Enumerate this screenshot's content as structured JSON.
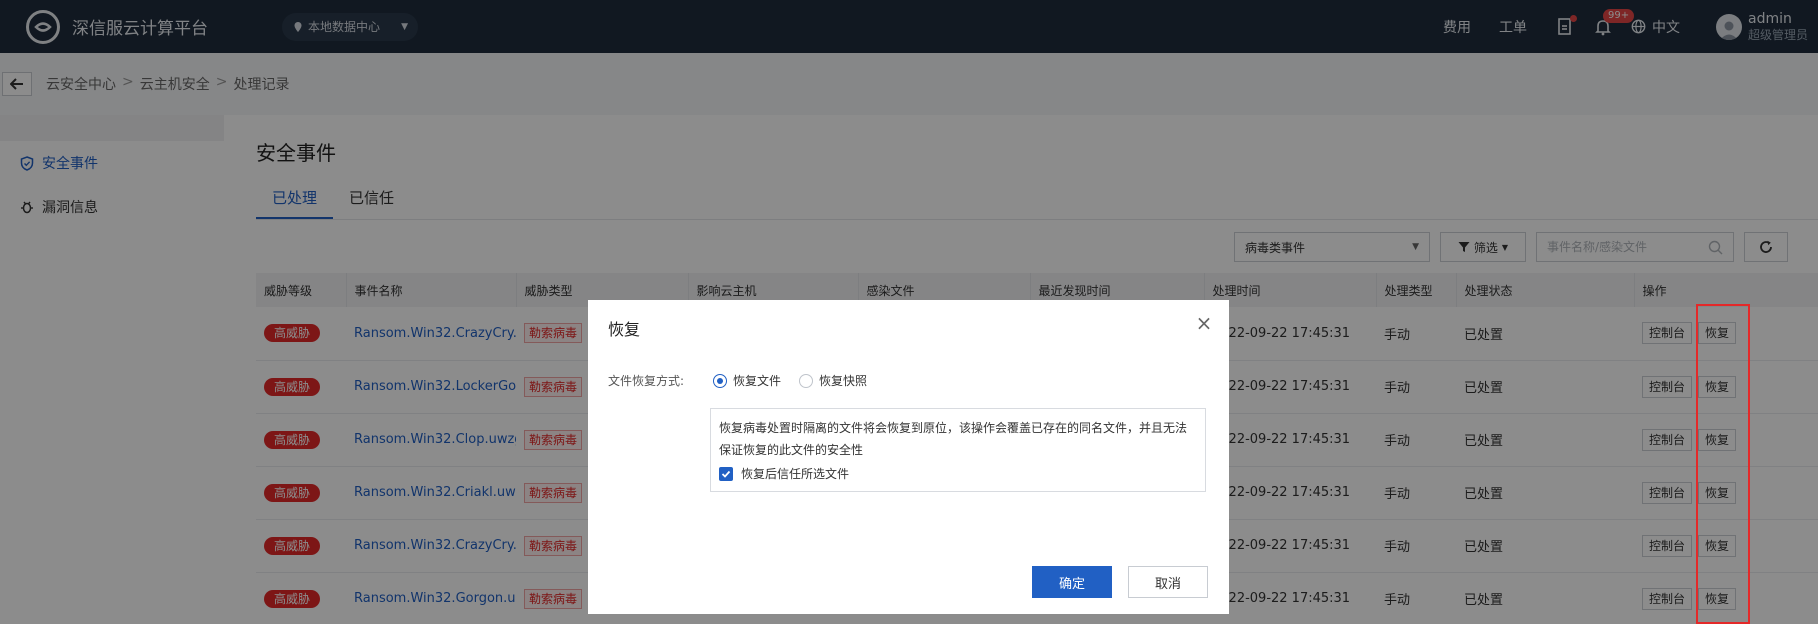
{
  "topbar": {
    "app_title": "深信服云计算平台",
    "datacenter": "本地数据中心",
    "links": {
      "fee": "费用",
      "ticket": "工单"
    },
    "notif_badge": "99+",
    "lang": "中文",
    "user_name": "admin",
    "user_role": "超级管理员"
  },
  "breadcrumb": {
    "items": [
      "云安全中心",
      "云主机安全",
      "处理记录"
    ],
    "separator": ">"
  },
  "sidebar": {
    "items": [
      {
        "label": "安全事件"
      },
      {
        "label": "漏洞信息"
      }
    ]
  },
  "page": {
    "title": "安全事件",
    "tabs": [
      {
        "label": "已处理"
      },
      {
        "label": "已信任"
      }
    ],
    "filter_select": "病毒类事件",
    "filter_btn": "筛选",
    "search_placeholder": "事件名称/感染文件"
  },
  "table": {
    "headers": [
      "威胁等级",
      "事件名称",
      "威胁类型",
      "影响云主机",
      "感染文件",
      "最近发现时间",
      "处理时间",
      "处理类型",
      "处理状态",
      "操作"
    ],
    "rows": [
      {
        "level": "高威胁",
        "name": "Ransom.Win32.CrazyCry...",
        "type": "勒索病毒",
        "time": "2022-09-22 17:45:31",
        "method": "手动",
        "status": "已处置"
      },
      {
        "level": "高威胁",
        "name": "Ransom.Win32.LockerGo...",
        "type": "勒索病毒",
        "time": "2022-09-22 17:45:31",
        "method": "手动",
        "status": "已处置"
      },
      {
        "level": "高威胁",
        "name": "Ransom.Win32.Clop.uwzg",
        "type": "勒索病毒",
        "time": "2022-09-22 17:45:31",
        "method": "手动",
        "status": "已处置"
      },
      {
        "level": "高威胁",
        "name": "Ransom.Win32.Criakl.uwzg",
        "type": "勒索病毒",
        "time": "2022-09-22 17:45:31",
        "method": "手动",
        "status": "已处置"
      },
      {
        "level": "高威胁",
        "name": "Ransom.Win32.CrazyCry...",
        "type": "勒索病毒",
        "time": "2022-09-22 17:45:31",
        "method": "手动",
        "status": "已处置"
      },
      {
        "level": "高威胁",
        "name": "Ransom.Win32.Gorgon.u...",
        "type": "勒索病毒",
        "time": "2022-09-22 17:45:31",
        "method": "手动",
        "status": "已处置"
      }
    ],
    "op_console": "控制台",
    "op_restore": "恢复"
  },
  "modal": {
    "title": "恢复",
    "field_label": "文件恢复方式:",
    "options": [
      {
        "label": "恢复文件",
        "selected": true
      },
      {
        "label": "恢复快照",
        "selected": false
      }
    ],
    "info": "恢复病毒处置时隔离的文件将会恢复到原位，该操作会覆盖已存在的同名文件，并且无法保证恢复的此文件的安全性",
    "checkbox_label": "恢复后信任所选文件",
    "ok": "确定",
    "cancel": "取消"
  }
}
